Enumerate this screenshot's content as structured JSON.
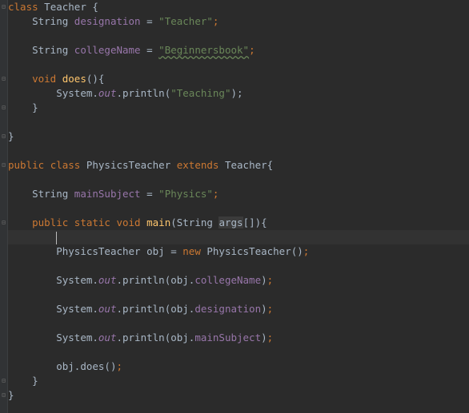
{
  "code": {
    "l1": {
      "kw1": "class",
      "name": "Teacher {"
    },
    "l2": {
      "type": "String",
      "field": "designation",
      "eq": " = ",
      "value": "\"Teacher\"",
      "end": ";"
    },
    "l3": {
      "type": "String",
      "field": "collegeName",
      "eq": " = ",
      "value": "\"Beginnersbook\"",
      "end": ";"
    },
    "l4": {
      "kw": "void",
      "fn": "does",
      "rest": "(){"
    },
    "l5": {
      "a": "System.",
      "f": "out",
      "b": ".println(",
      "value": "\"Teaching\"",
      "c": ");"
    },
    "l6": {
      "text": "}"
    },
    "l7": {
      "text": "}"
    },
    "l8": {
      "kw1": "public",
      "kw2": "class",
      "name": "PhysicsTeacher",
      "kw3": "extends",
      "parent": "Teacher{"
    },
    "l9": {
      "type": "String",
      "field": "mainSubject",
      "eq": " = ",
      "value": "\"Physics\"",
      "end": ";"
    },
    "l10": {
      "kw1": "public",
      "kw2": "static",
      "kw3": "void",
      "fn": "main",
      "a": "(String ",
      "arg": "args",
      "b": "[]){"
    },
    "l11": {
      "a": "PhysicsTeacher obj = ",
      "kw": "new",
      "b": " PhysicsTeacher()",
      "end": ";"
    },
    "l12": {
      "a": "System.",
      "f": "out",
      "b": ".println(obj.",
      "field": "collegeName",
      "c": ")",
      "end": ";"
    },
    "l13": {
      "a": "System.",
      "f": "out",
      "b": ".println(obj.",
      "field": "designation",
      "c": ")",
      "end": ";"
    },
    "l14": {
      "a": "System.",
      "f": "out",
      "b": ".println(obj.",
      "field": "mainSubject",
      "c": ")",
      "end": ";"
    },
    "l15": {
      "a": "obj.does()",
      "end": ";"
    },
    "l16": {
      "text": "}"
    },
    "l17": {
      "text": "}"
    }
  },
  "colors": {
    "background": "#2b2b2b",
    "keyword": "#cc7832",
    "string": "#6a8759",
    "field": "#9876aa",
    "method": "#ffc66d",
    "text": "#a9b7c6"
  }
}
